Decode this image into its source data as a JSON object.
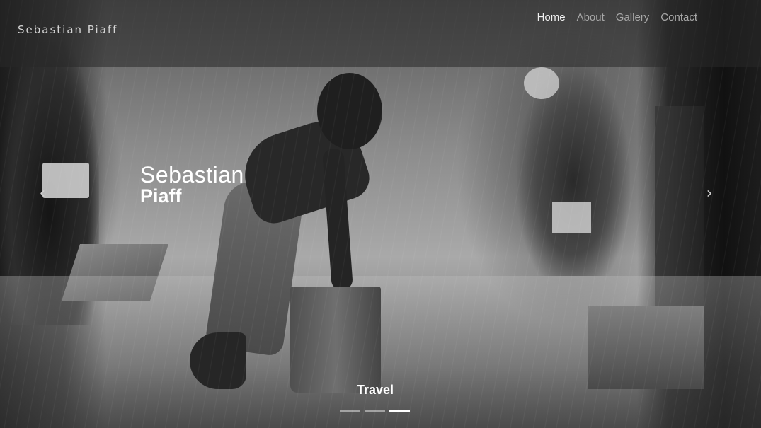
{
  "site": {
    "brand": "Sebastian Piaff"
  },
  "nav": {
    "items": [
      {
        "label": "Home",
        "active": true
      },
      {
        "label": "About",
        "active": false
      },
      {
        "label": "Gallery",
        "active": false
      },
      {
        "label": "Contact",
        "active": false
      }
    ]
  },
  "hero": {
    "first_name": "Sebastian",
    "last_name": "Piaff",
    "photo_subject": "black-and-white photo of a boy with a bucket in the rain",
    "slide_caption": "Travel",
    "prev_icon": "chevron-left-icon",
    "next_icon": "chevron-right-icon",
    "slide_count": 3,
    "active_slide": 3
  }
}
